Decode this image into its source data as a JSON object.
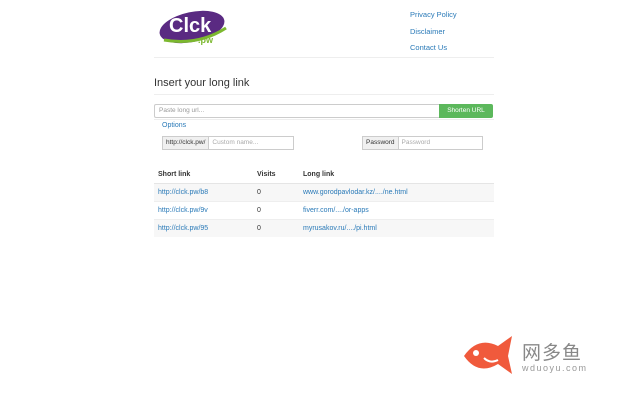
{
  "logo": {
    "text": "Clck",
    "sub": ".pw",
    "color": "#5a2a82",
    "accent": "#7cb82f"
  },
  "nav": {
    "items": [
      {
        "label": "Privacy Policy"
      },
      {
        "label": "Disclaimer"
      },
      {
        "label": "Contact Us"
      }
    ]
  },
  "heading": "Insert your long link",
  "url_form": {
    "placeholder": "Paste long url...",
    "button_label": "Shorten URL"
  },
  "options_label": "Options",
  "custom": {
    "prefix": "http://clck.pw/",
    "placeholder": "Custom name..."
  },
  "password": {
    "label": "Password",
    "placeholder": "Password"
  },
  "table": {
    "headers": [
      "Short link",
      "Visits",
      "Long link"
    ],
    "rows": [
      {
        "short": "http://clck.pw/b8",
        "visits": "0",
        "long": "www.gorodpavlodar.kz/..../ne.html"
      },
      {
        "short": "http://clck.pw/9v",
        "visits": "0",
        "long": "fiverr.com/..../or-apps"
      },
      {
        "short": "http://clck.pw/95",
        "visits": "0",
        "long": "myrusakov.ru/..../pi.html"
      }
    ]
  },
  "watermark": {
    "text": "网多鱼",
    "sub": "wduoyu.com",
    "icon": "fish-icon",
    "color": "#f05a3c"
  },
  "colors": {
    "link": "#2a7ab8",
    "button": "#5cb85c"
  }
}
